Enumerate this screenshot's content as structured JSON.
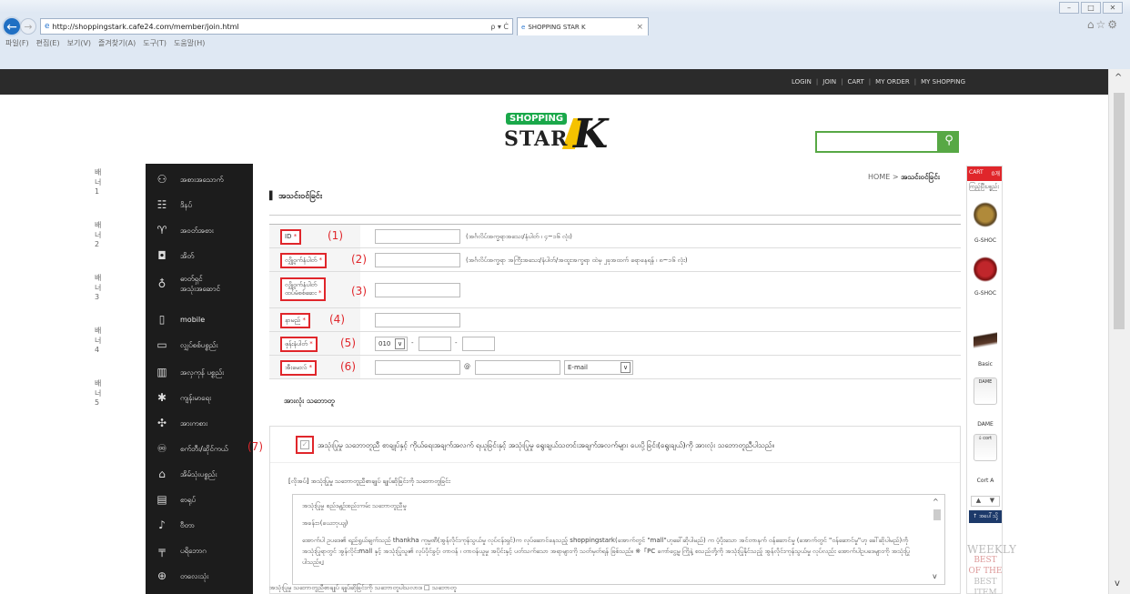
{
  "browser": {
    "address": "http://shoppingstark.cafe24.com/member/join.html",
    "address_tools": "ρ ▾ Ċ",
    "tab_title": "SHOPPING STAR K",
    "tab_close": "×",
    "menu": [
      "파일(F)",
      "편집(E)",
      "보기(V)",
      "즐겨찾기(A)",
      "도구(T)",
      "도움말(H)"
    ]
  },
  "topbar": {
    "links": [
      "LOGIN",
      "JOIN",
      "CART",
      "MY ORDER",
      "MY SHOPPING"
    ]
  },
  "logo": {
    "top": "SHOPPING",
    "main": "STAR",
    "letter": "K"
  },
  "search": {
    "placeholder": "",
    "icon": "magnifier"
  },
  "left_labels": [
    "배너1",
    "배너2",
    "배너3",
    "배너4",
    "배너5"
  ],
  "sidebar": {
    "items": [
      {
        "label": "အစားအသောက်",
        "icon": "food-icon"
      },
      {
        "label": "ဒိနပ်",
        "icon": "stand-icon"
      },
      {
        "label": "အဝတ်အစား",
        "icon": "shirt-icon"
      },
      {
        "label": "အိတ်",
        "icon": "bag-icon"
      },
      {
        "label": "ဓာတ်ရှင်\nအသုံးအဆောင်",
        "icon": "bulb-icon"
      },
      {
        "label": "mobile",
        "icon": "mobile-icon"
      },
      {
        "label": "လျှပ်စစ်ပစ္စည်း",
        "icon": "tv-icon"
      },
      {
        "label": "အလှကုန် ပစ္စည်း",
        "icon": "cosmetics-icon"
      },
      {
        "label": "ကျန်းမာရေး",
        "icon": "health-icon"
      },
      {
        "label": "အားကစား",
        "icon": "sports-icon"
      },
      {
        "label": "စက်ဘီး/ဆိုင်ကယ်",
        "icon": "bike-icon"
      },
      {
        "label": "အိမ်သုံးပစ္စည်း",
        "icon": "home-icon"
      },
      {
        "label": "စာရုပ်",
        "icon": "book-icon"
      },
      {
        "label": "ဗီတာ",
        "icon": "guitar-icon"
      },
      {
        "label": "ပရိဘောဂ",
        "icon": "furniture-icon"
      },
      {
        "label": "တလေးသုံး",
        "icon": "baby-icon"
      }
    ]
  },
  "breadcrumb": {
    "home": "HOME",
    "sep": ">",
    "current": "အသင်းဝင်ခြင်း"
  },
  "page_title": "အသင်းဝင်ခြင်း",
  "form": {
    "rows": [
      {
        "label": "ID",
        "num": "(1)",
        "note": "(အင်္ဂလိပ်အက္ခရာအသေး/နံပါတ် ၊ ၄~၁၆ လုံး)"
      },
      {
        "label": "လျှို့ဝှက်နံပါတ်",
        "num": "(2)",
        "note": "(အင်္ဂလိပ်အက္ခရာ အကြီးအသေး/နံပါတ်/အထူးအက္ခရာ ထဲမှ ၂ခုအထက် ရောနေရန် ၊ ၈~၁၆ လုံး)"
      },
      {
        "label": "လျှို့ဝှက်နံပါတ်\nထပ်မံစစ်ဆေး",
        "num": "(3)",
        "note": ""
      },
      {
        "label": "နာမည်",
        "num": "(4)",
        "note": ""
      },
      {
        "label": "ဖုန်းနံပါတ်",
        "num": "(5)",
        "note": ""
      },
      {
        "label": "အီးမေးလ်",
        "num": "(6)",
        "note": ""
      }
    ],
    "required_mark": "*",
    "phone_prefix": "010",
    "phone_dash": "-",
    "email_at": "@",
    "email_select": "E-mail"
  },
  "agreement": {
    "section_title": "အားလုံး သဘောတူ",
    "num": "(7)",
    "check_text": "အသုံးပြုမှု သဘောတူညီ စာချုပ်နှင့် ကိုယ်ရေးအချက်အလက် ရယူခြင်းနှင့် အသုံးပြုမှု ရွေးချယ်သတင်းအချက်အလက်များ ပေးပို့ခြင်း(ရွေးချယ်)ကို အားလုံး သဘောတူညီပါသည်။",
    "sub_title": "[လိုအပ်] အသုံးပြုမှု သဘောတူညီစာချုပ် ချုပ်ဆိုခြင်းကို သဘောတူခြင်း",
    "terms": [
      "အသုံးပြုမှု စည်းမျဉ်းစည်းကမ်း သဘောတူညီမှု",
      "အခန်း၁(ယေဘုယျ)",
      "အောက်ပါ ဥပဒေ၏ ရည်ရွယ်ချက်သည် thankha ကုမ္ပဏီ(အွန်လိုင်းကုန်သွယ်မှု လုပ်ငန်းရှင်)က လုပ်ဆောင်နေသည့် shoppingstark(အောက်တွင် \"mall\"ဟုခေါ်ဆိုပါမည်) က ပံ့ပိုးသော အင်တာနက် ဝန်ဆောင်မှု (အောက်တွင် \"ဝန်ဆောင်မှု\"ဟု ခေါ်ဆိုပါမည်)ကို အသုံးပြုရာတွင် အွန်လိုင်းmall နှင့် အသုံးပြုသူ၏ လုပ်ပိုင်ခွင့်၊ တာဝန် ၊ တာဝန်ယူမှု အပိုင်းနှင့် ပတ်သက်သော အရာများကို သတ်မှတ်ရန် ဖြစ်သည်။ ※「PC ကော်ငွေ့မှု ကြိုနဲ့ စသည်တို့ကို အသုံးပြုနိုင်သည့် အွန်လိုင်းကုန်သွယ်မှု လုပ်လည်း အောက်ပါဥပဒေများကို အသုံးပြုပါသည်။」"
    ],
    "bottom_line": "အသုံးပြုမှု သဘောတူညီစာချုပ် ချုပ်ဆိုခြင်းကို သဘောတူပါသလား။ □ သဘောတူ"
  },
  "cart": {
    "head": "CART",
    "count": "0개",
    "sub": "ကြည့်ပြီးပစ္စည်း",
    "items": [
      {
        "label": "G-SHOC"
      },
      {
        "label": "G-SHOC"
      },
      {
        "label": "Basic"
      },
      {
        "label": "DAME",
        "top": "DAME"
      },
      {
        "label": "Cort A",
        "top": "ခံ cort"
      }
    ],
    "nav_up": "▲",
    "nav_down": "▼",
    "top_btn": "↑ အပေါ်သို့",
    "weekly": [
      "WEEKLY",
      "BEST OF THE",
      "BEST ITEM"
    ]
  }
}
